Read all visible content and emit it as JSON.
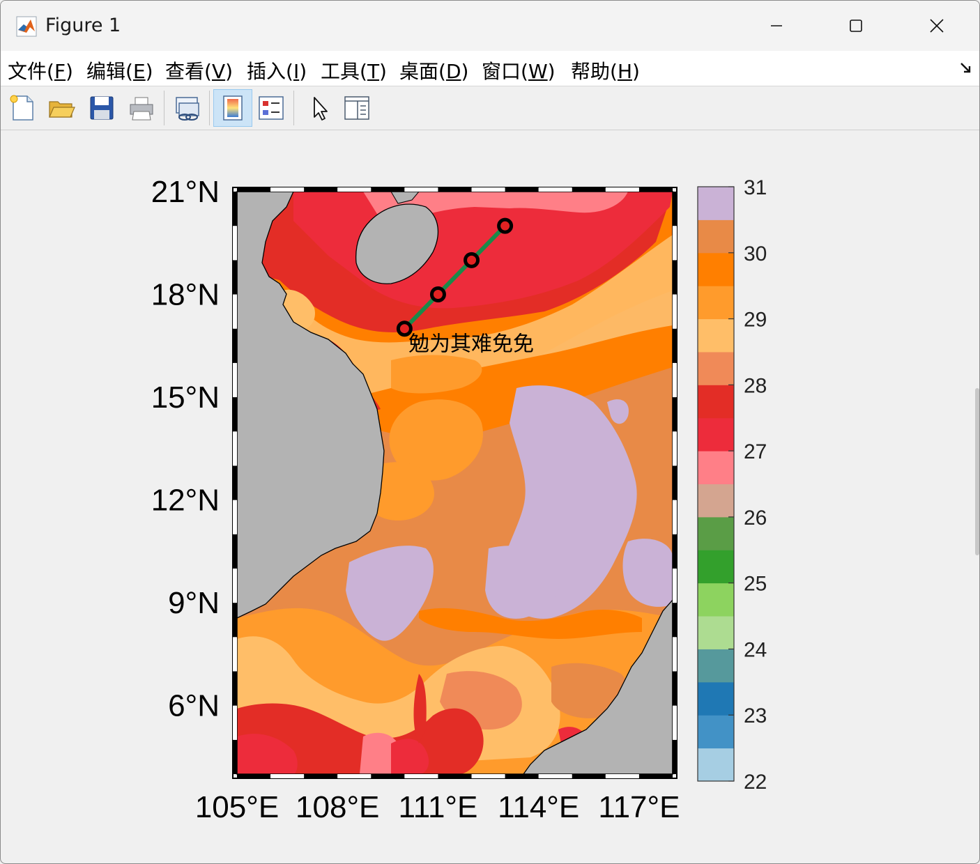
{
  "window": {
    "title": "Figure 1",
    "icon": "matlab-icon",
    "controls": [
      "minimize-icon",
      "maximize-icon",
      "close-icon"
    ]
  },
  "menu": [
    {
      "label": "文件(",
      "mnemonic": "F",
      "close": ")"
    },
    {
      "label": "编辑(",
      "mnemonic": "E",
      "close": ")"
    },
    {
      "label": "查看(",
      "mnemonic": "V",
      "close": ")"
    },
    {
      "label": "插入(",
      "mnemonic": "I",
      "close": ")"
    },
    {
      "label": "工具(",
      "mnemonic": "T",
      "close": ")"
    },
    {
      "label": "桌面(",
      "mnemonic": "D",
      "close": ")"
    },
    {
      "label": "窗口(",
      "mnemonic": "W",
      "close": ")"
    },
    {
      "label": "帮助(",
      "mnemonic": "H",
      "close": ")"
    }
  ],
  "menu_dock_icon": "dock-arrow-icon",
  "toolbar": [
    "new-figure-icon",
    "open-file-icon",
    "save-icon",
    "print-icon",
    "link-plot-icon",
    "colorbar-icon",
    "legend-icon",
    "edit-plot-arrow-icon",
    "property-inspector-icon"
  ],
  "toolbar_active": "colorbar-icon",
  "chart_data": {
    "type": "heatmap",
    "title": "",
    "xlabel": "",
    "ylabel": "",
    "xlim": [
      105,
      118
    ],
    "ylim": [
      4,
      21
    ],
    "xticks": [
      105,
      108,
      111,
      114,
      117
    ],
    "xtick_labels": [
      "105°E",
      "108°E",
      "111°E",
      "114°E",
      "117°E"
    ],
    "yticks": [
      6,
      9,
      12,
      15,
      18,
      21
    ],
    "ytick_labels": [
      "6°N",
      "9°N",
      "12°N",
      "15°N",
      "18°N",
      "21°N"
    ],
    "colorbar": {
      "min": 22,
      "max": 31,
      "ticks": [
        22,
        23,
        24,
        25,
        26,
        27,
        28,
        29,
        30,
        31
      ],
      "tick_labels": [
        "22",
        "23",
        "24",
        "25",
        "26",
        "27",
        "28",
        "29",
        "30",
        "31"
      ],
      "colors": [
        "#a6cee3",
        "#4292c6",
        "#1f78b4",
        "#56999c",
        "#addc91",
        "#8dd35f",
        "#33a02c",
        "#5a9d46",
        "#d4a590",
        "#ff7f87",
        "#ed2c3b",
        "#e32d26",
        "#f08a58",
        "#ffbe68",
        "#ff9b2c",
        "#ff7f00",
        "#e88a47",
        "#cab2d6"
      ],
      "placement": "right"
    },
    "track": {
      "lon": [
        110.0,
        111.0,
        112.0,
        113.0
      ],
      "lat": [
        17.0,
        18.0,
        19.0,
        20.0
      ],
      "line_color": "#1a8a4a",
      "marker_edge": "#000000",
      "marker_face": "#e32222"
    },
    "annotation": {
      "text": "勉为其难免免",
      "lon": 110.2,
      "lat": 16.6
    },
    "land_color": "#b3b3b3",
    "frame": "black-white-dashed"
  }
}
